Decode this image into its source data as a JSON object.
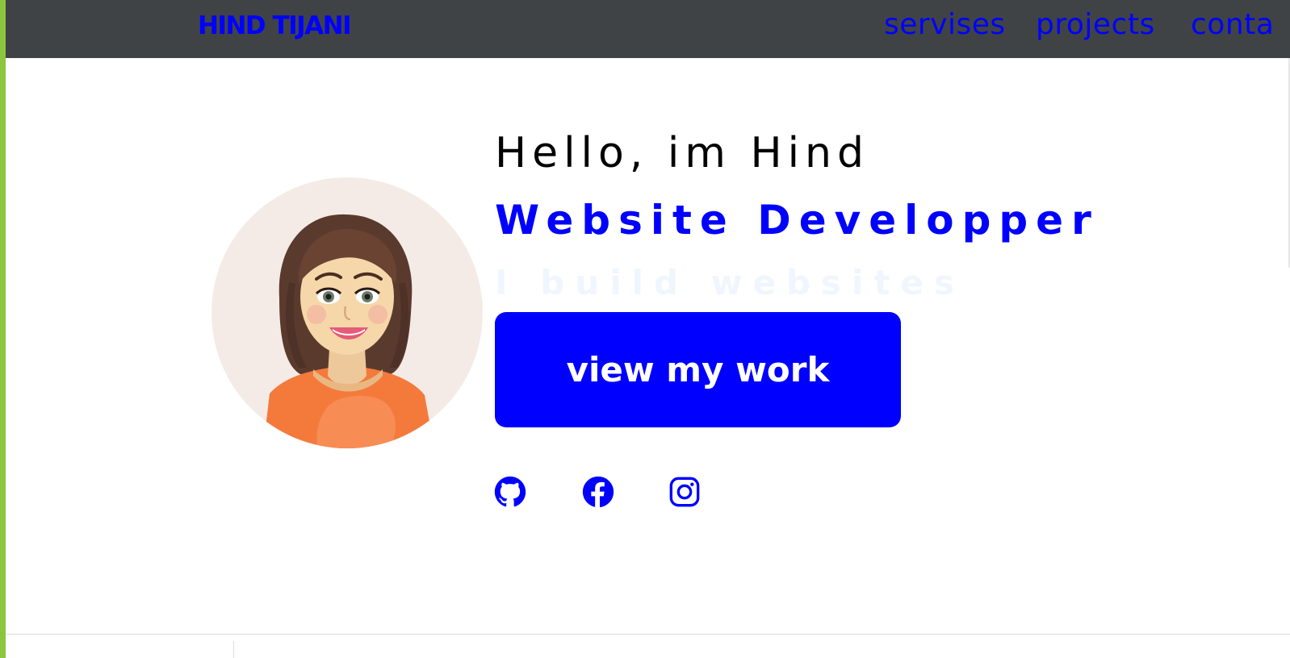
{
  "header": {
    "brand": "HIND TIJANI",
    "nav": [
      {
        "label": "servises"
      },
      {
        "label": "projects"
      },
      {
        "label": "conta"
      }
    ]
  },
  "hero": {
    "greeting": "Hello, im Hind",
    "role": "Website Developper",
    "tagline": "I build websites",
    "cta_label": "view my work",
    "avatar_icon": "cartoon-woman-avatar"
  },
  "social": [
    {
      "icon": "github-icon"
    },
    {
      "icon": "facebook-icon"
    },
    {
      "icon": "instagram-icon"
    }
  ],
  "colors": {
    "accent": "#0000ff",
    "navbar": "#3f4346",
    "left_strip": "#8cc63f",
    "avatar_bg": "#f4ebe6",
    "tagline": "#f0f6fd"
  }
}
